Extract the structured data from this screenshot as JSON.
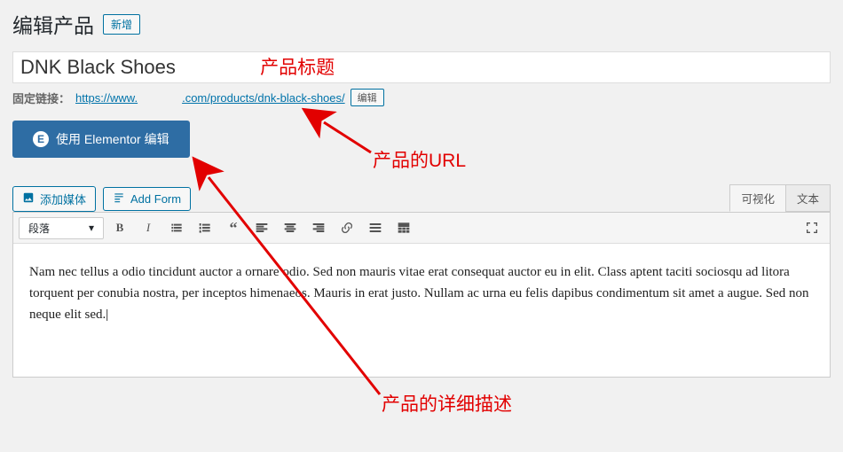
{
  "header": {
    "page_title": "编辑产品",
    "add_new_label": "新增"
  },
  "title": {
    "value": "DNK Black Shoes"
  },
  "annotations": {
    "title": "产品标题",
    "url": "产品的URL",
    "description": "产品的详细描述"
  },
  "permalink": {
    "label": "固定链接：",
    "prefix": "https://www.",
    "mid": ".com/products/",
    "slug": "dnk-black-shoes/",
    "edit_label": "编辑"
  },
  "elementor": {
    "label": "使用 Elementor 编辑"
  },
  "media": {
    "add_media_label": "添加媒体",
    "add_form_label": "Add Form"
  },
  "tabs": {
    "visual": "可视化",
    "text": "文本"
  },
  "toolbar": {
    "format_label": "段落"
  },
  "content": {
    "body": "Nam nec tellus a odio tincidunt auctor a ornare odio. Sed non mauris vitae erat consequat auctor eu in elit. Class aptent taciti sociosqu ad litora torquent per conubia nostra, per inceptos himenaeos. Mauris in erat justo. Nullam ac urna eu felis dapibus condimentum sit amet a augue. Sed non neque elit sed."
  }
}
